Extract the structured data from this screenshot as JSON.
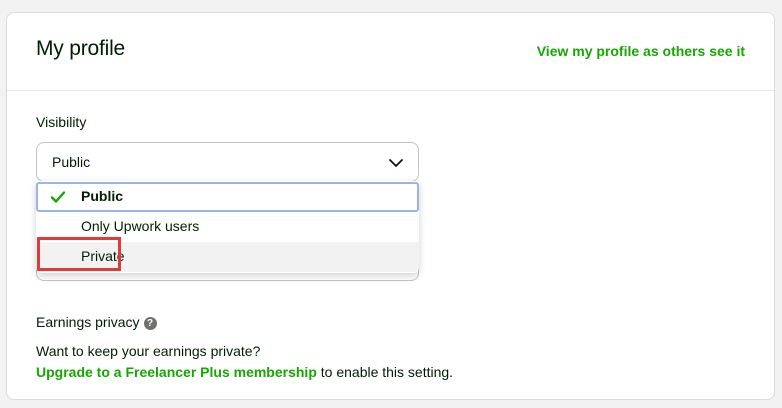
{
  "header": {
    "title": "My profile",
    "view_link": "View my profile as others see it"
  },
  "visibility": {
    "label": "Visibility",
    "selected_value": "Public",
    "options": [
      {
        "label": "Public",
        "checked": true
      },
      {
        "label": "Only Upwork users",
        "checked": false
      },
      {
        "label": "Private",
        "checked": false
      }
    ]
  },
  "earnings": {
    "label": "Earnings privacy",
    "help_icon": "question-circle-icon",
    "help_glyph": "?",
    "description": "Want to keep your earnings private?",
    "upgrade_link": "Upgrade to a Freelancer Plus membership",
    "upgrade_suffix": " to enable this setting."
  },
  "colors": {
    "accent": "#14a800",
    "highlight": "#e03a3a",
    "focus": "#9ab4e8"
  }
}
